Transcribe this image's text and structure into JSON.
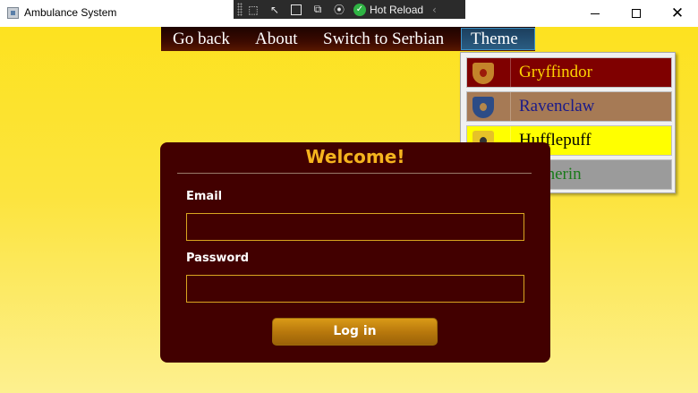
{
  "window": {
    "title": "Ambulance System",
    "icon": "app-icon",
    "controls": {
      "minimize": "minimize-icon",
      "maximize": "maximize-icon",
      "close": "close-icon"
    }
  },
  "debug_toolbar": {
    "icons": [
      "select-element-icon",
      "pointer-icon",
      "display-layout-icon",
      "track-focus-icon",
      "binding-icon"
    ],
    "hot_reload_label": "Hot Reload",
    "hot_reload_status_color": "#2fb344"
  },
  "menu": {
    "items": [
      {
        "label": "Go back"
      },
      {
        "label": "About"
      },
      {
        "label": "Switch to Serbian"
      },
      {
        "label": "Theme"
      }
    ],
    "active_item": "Theme"
  },
  "theme_menu": {
    "items": [
      {
        "label": "Gryffindor",
        "icon": "gryffindor-crest-icon",
        "background": "#7f0000",
        "text_color": "#ffd200"
      },
      {
        "label": "Ravenclaw",
        "icon": "ravenclaw-crest-icon",
        "background": "#a67a55",
        "text_color": "#1a1a8a"
      },
      {
        "label": "Hufflepuff",
        "icon": "hufflepuff-crest-icon",
        "background": "#ffff00",
        "text_color": "#000000"
      },
      {
        "label": "Slytherin",
        "icon": "slytherin-crest-icon",
        "background": "#9b9b9b",
        "text_color": "#1a7a1a"
      }
    ]
  },
  "login": {
    "title": "Welcome!",
    "email_label": "Email",
    "email_value": "",
    "password_label": "Password",
    "password_value": "",
    "submit_label": "Log in"
  },
  "colors": {
    "panel_background": "#420000",
    "accent": "#f5b41e",
    "page_background_top": "#fde21b"
  }
}
